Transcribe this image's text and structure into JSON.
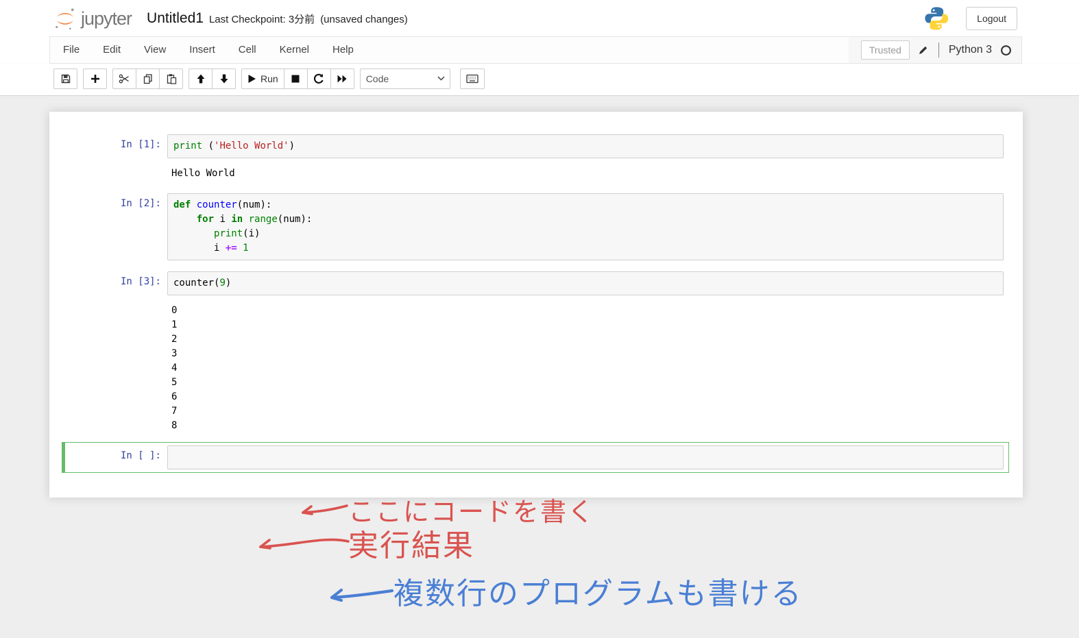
{
  "header": {
    "logo_text": "jupyter",
    "title": "Untitled1",
    "checkpoint_label": "Last Checkpoint: 3分前",
    "unsaved_label": "(unsaved changes)",
    "logout_label": "Logout"
  },
  "menubar": {
    "items": [
      "File",
      "Edit",
      "View",
      "Insert",
      "Cell",
      "Kernel",
      "Help"
    ],
    "trusted_label": "Trusted",
    "kernel_name": "Python 3"
  },
  "toolbar": {
    "run_label": "Run",
    "cell_type_value": "Code",
    "icons": {
      "save": "floppy-icon",
      "insert_cell": "plus-icon",
      "cut": "scissors-icon",
      "copy": "copy-icon",
      "paste": "paste-icon",
      "move_up": "arrow-up-icon",
      "move_down": "arrow-down-icon",
      "run": "play-icon",
      "interrupt": "stop-icon",
      "restart": "restart-icon",
      "restart_run_all": "fast-forward-icon",
      "command_palette": "keyboard-icon",
      "edit": "pencil-icon",
      "kernel_status": "kernel-idle-circle-icon",
      "dropdown": "chevron-down-icon"
    }
  },
  "notebook": {
    "cells": [
      {
        "prompt": "In [1]:",
        "selected": false,
        "source": [
          [
            {
              "t": "print",
              "s": "builtin"
            },
            {
              "t": " (",
              "s": "plain"
            },
            {
              "t": "'Hello World'",
              "s": "str"
            },
            {
              "t": ")",
              "s": "plain"
            }
          ]
        ],
        "outputs": [
          "Hello World"
        ]
      },
      {
        "prompt": "In [2]:",
        "selected": false,
        "source": [
          [
            {
              "t": "def",
              "s": "kw"
            },
            {
              "t": " ",
              "s": "plain"
            },
            {
              "t": "counter",
              "s": "defname"
            },
            {
              "t": "(num):",
              "s": "plain"
            }
          ],
          [
            {
              "t": "    ",
              "s": "plain"
            },
            {
              "t": "for",
              "s": "kw"
            },
            {
              "t": " i ",
              "s": "plain"
            },
            {
              "t": "in",
              "s": "kw"
            },
            {
              "t": " ",
              "s": "plain"
            },
            {
              "t": "range",
              "s": "builtin"
            },
            {
              "t": "(num):",
              "s": "plain"
            }
          ],
          [
            {
              "t": "       ",
              "s": "plain"
            },
            {
              "t": "print",
              "s": "builtin"
            },
            {
              "t": "(i)",
              "s": "plain"
            }
          ],
          [
            {
              "t": "       i ",
              "s": "plain"
            },
            {
              "t": "+=",
              "s": "op"
            },
            {
              "t": " ",
              "s": "plain"
            },
            {
              "t": "1",
              "s": "num"
            }
          ]
        ],
        "outputs": []
      },
      {
        "prompt": "In [3]:",
        "selected": false,
        "source": [
          [
            {
              "t": "counter(",
              "s": "plain"
            },
            {
              "t": "9",
              "s": "num"
            },
            {
              "t": ")",
              "s": "plain"
            }
          ]
        ],
        "outputs": [
          "0",
          "1",
          "2",
          "3",
          "4",
          "5",
          "6",
          "7",
          "8"
        ]
      },
      {
        "prompt": "In [ ]:",
        "selected": true,
        "source": [
          []
        ],
        "outputs": []
      }
    ]
  },
  "annotations": {
    "code_here": {
      "text": "ここにコードを書く",
      "color": "#d9534f",
      "icon": "left-arrow"
    },
    "run_result": {
      "text": "実行結果",
      "color": "#d9534f",
      "icon": "left-arrow"
    },
    "multiline": {
      "text": "複数行のプログラムも書ける",
      "color": "#4a7fd4",
      "icon": "left-arrow"
    }
  },
  "colors": {
    "annotation_red": "#d9534f",
    "annotation_blue": "#4a7fd4",
    "selected_cell_green": "#66bb6a",
    "prompt_blue": "#303f9f",
    "jupyter_orange": "#f37726",
    "cell_input_bg": "#f7f7f7",
    "page_bg": "#eeeeee"
  }
}
